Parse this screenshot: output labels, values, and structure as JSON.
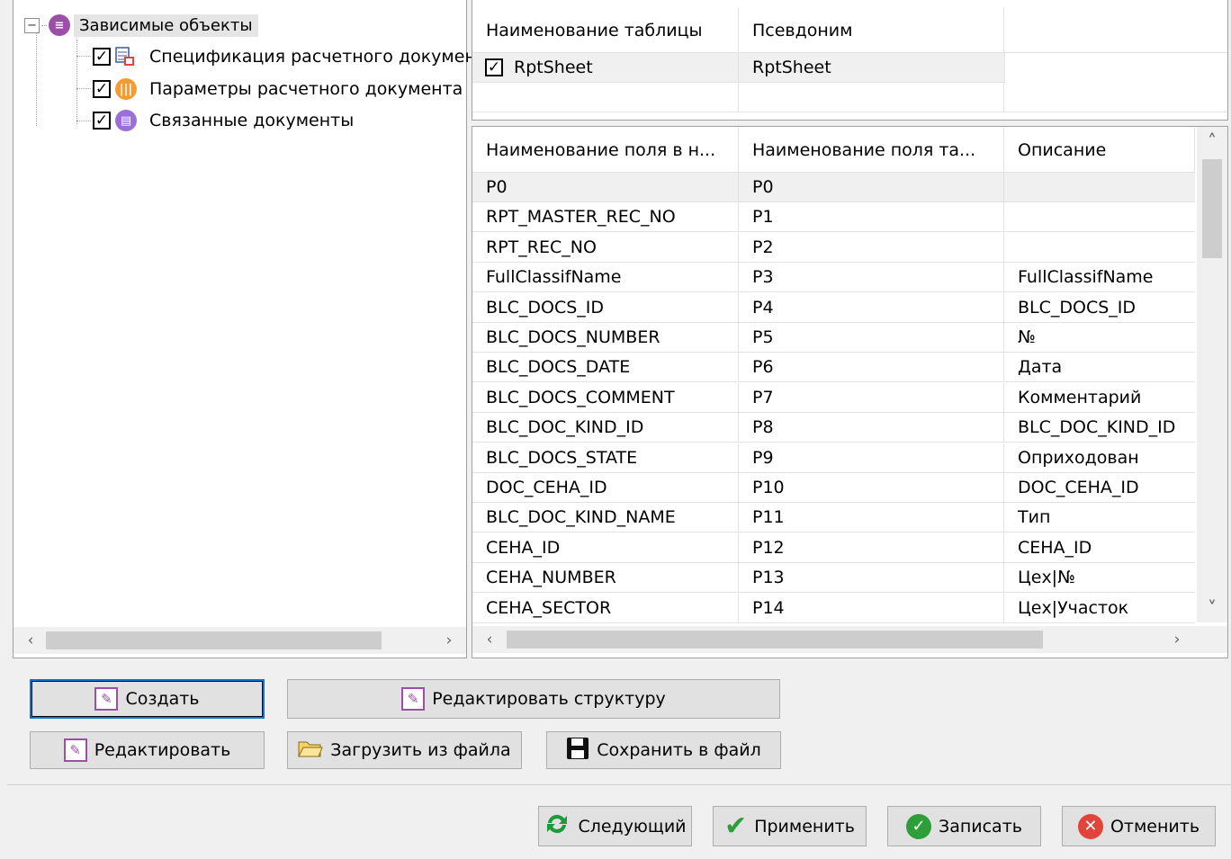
{
  "tree": {
    "root": {
      "label": "Зависимые объекты",
      "expander": "⊟"
    },
    "children": [
      {
        "label": "Спецификация расчетного документа",
        "checked": "✓",
        "icon": "table-spec-icon"
      },
      {
        "label": "Параметры расчетного документа",
        "checked": "✓",
        "icon": "params-icon"
      },
      {
        "label": "Связанные документы",
        "checked": "✓",
        "icon": "linked-docs-icon"
      }
    ]
  },
  "tables_grid": {
    "headers": [
      "Наименование таблицы",
      "Псевдоним"
    ],
    "rows": [
      {
        "name": "RptSheet",
        "alias": "RptSheet",
        "checked": "✓"
      }
    ]
  },
  "fields_grid": {
    "headers": [
      "Наименование поля в н...",
      "Наименование поля та...",
      "Описание"
    ],
    "rows": [
      [
        "P0",
        "P0",
        ""
      ],
      [
        "RPT_MASTER_REC_NO",
        "P1",
        ""
      ],
      [
        "RPT_REC_NO",
        "P2",
        ""
      ],
      [
        "FullClassifName",
        "P3",
        "FullClassifName"
      ],
      [
        "BLC_DOCS_ID",
        "P4",
        "BLC_DOCS_ID"
      ],
      [
        "BLC_DOCS_NUMBER",
        "P5",
        "№"
      ],
      [
        "BLC_DOCS_DATE",
        "P6",
        "Дата"
      ],
      [
        "BLC_DOCS_COMMENT",
        "P7",
        "Комментарий"
      ],
      [
        "BLC_DOC_KIND_ID",
        "P8",
        "BLC_DOC_KIND_ID"
      ],
      [
        "BLC_DOCS_STATE",
        "P9",
        "Оприходован"
      ],
      [
        "DOC_CEHA_ID",
        "P10",
        "DOC_CEHA_ID"
      ],
      [
        "BLC_DOC_KIND_NAME",
        "P11",
        "Тип"
      ],
      [
        "CEHA_ID",
        "P12",
        "CEHA_ID"
      ],
      [
        "CEHA_NUMBER",
        "P13",
        "Цех|№"
      ],
      [
        "CEHA_SECTOR",
        "P14",
        "Цех|Участок"
      ]
    ]
  },
  "scroll": {
    "left": "‹",
    "right": "›",
    "up": "˄",
    "down": "˅"
  },
  "actions": {
    "create": "Создать",
    "edit_structure": "Редактировать структуру",
    "edit": "Редактировать",
    "load": "Загрузить из файла",
    "save": "Сохранить в файл"
  },
  "footer": {
    "next": "Следующий",
    "apply": "Применить",
    "write": "Записать",
    "cancel": "Отменить"
  },
  "colors": {
    "accent_purple": "#9b4fa9",
    "orange": "#f39c33",
    "green": "#2e9e3a",
    "red": "#e0443a",
    "selection": "#f0f0f0"
  }
}
